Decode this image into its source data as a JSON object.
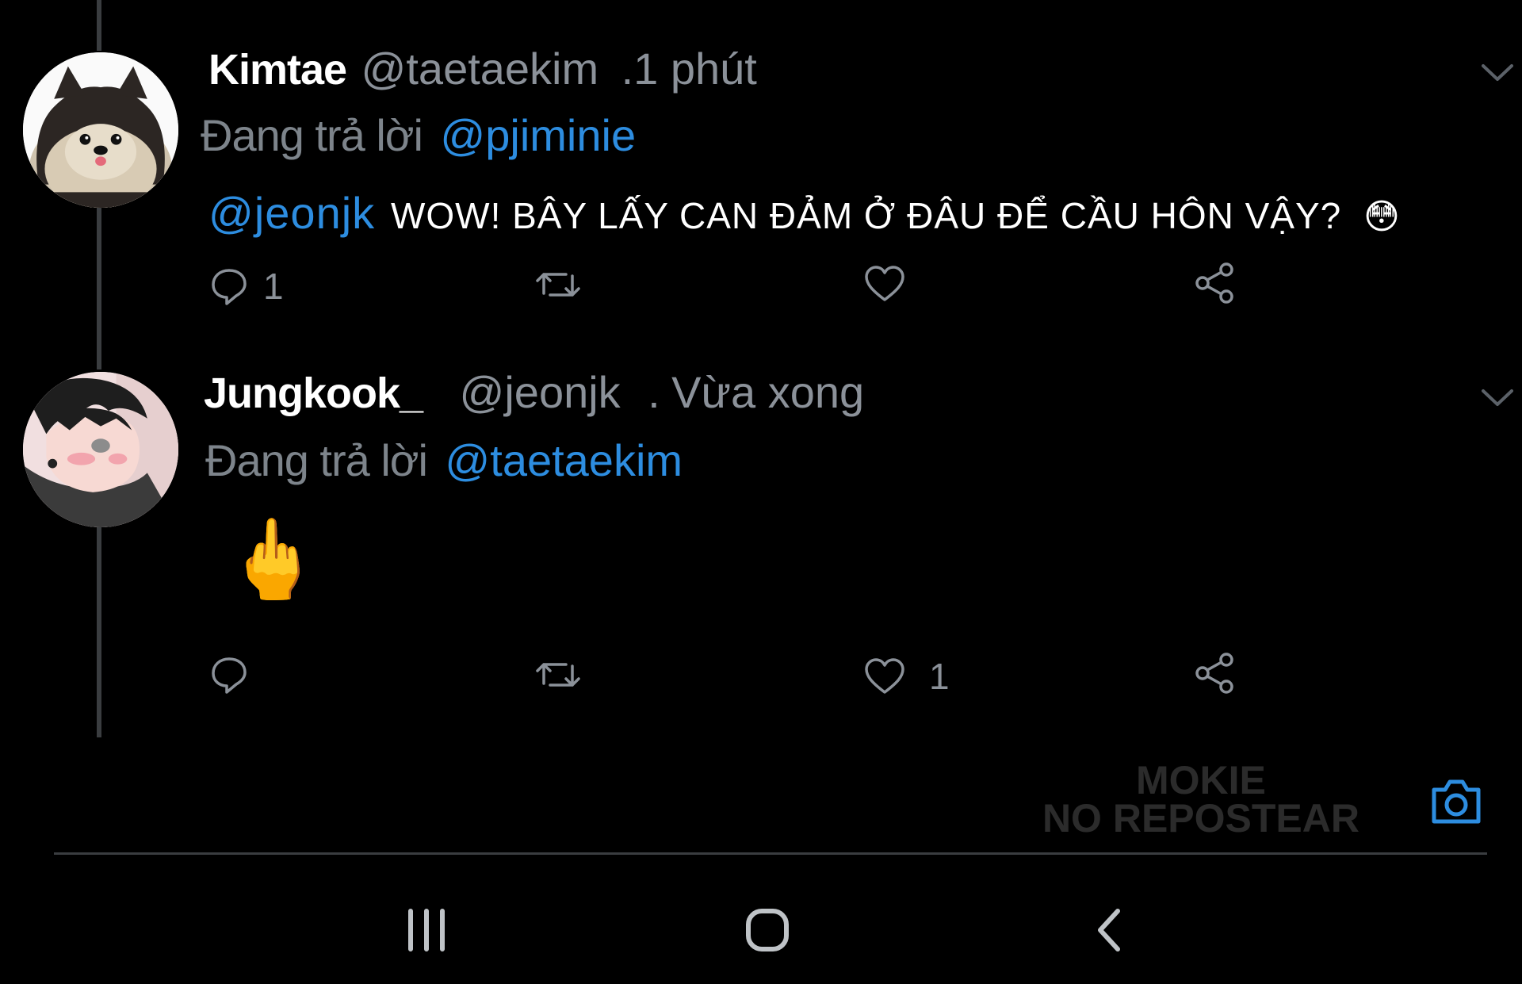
{
  "tweets": [
    {
      "display_name": "Kimtae",
      "handle": "@taetaekim",
      "separator": ".",
      "time": "1 phút",
      "reply_label": "Đang trả lời",
      "reply_to": "@pjiminie",
      "text_mention": "@jeonjk",
      "text_body": "WOW! BÂY LẤY CAN ĐẢM Ở ĐÂU ĐỂ CẦU HÔN VẬY?",
      "text_emoji": "😳",
      "avatar_icon": "dog-avatar",
      "actions": {
        "reply_count": "1",
        "retweet_count": "",
        "like_count": "",
        "share_count": ""
      }
    },
    {
      "display_name": "Jungkook_",
      "handle": "@jeonjk",
      "separator": ".",
      "time": "Vừa xong",
      "reply_label": "Đang trả lời",
      "reply_to": "@taetaekim",
      "text_emoji": "🖕",
      "avatar_icon": "boy-avatar",
      "actions": {
        "reply_count": "",
        "retweet_count": "",
        "like_count": "1",
        "share_count": ""
      }
    }
  ],
  "watermark": {
    "line1": "MOKIE",
    "line2": "NO REPOSTEAR"
  },
  "icons": {
    "reply": "speech-bubble-icon",
    "retweet": "retweet-icon",
    "like": "heart-icon",
    "share": "share-icon",
    "more": "chevron-down-icon",
    "camera": "camera-icon"
  },
  "colors": {
    "background": "#000000",
    "link": "#2d8de0",
    "muted": "#8b9199"
  },
  "navbar": {
    "recent": "recent-apps-icon",
    "home": "home-icon",
    "back": "back-icon"
  }
}
